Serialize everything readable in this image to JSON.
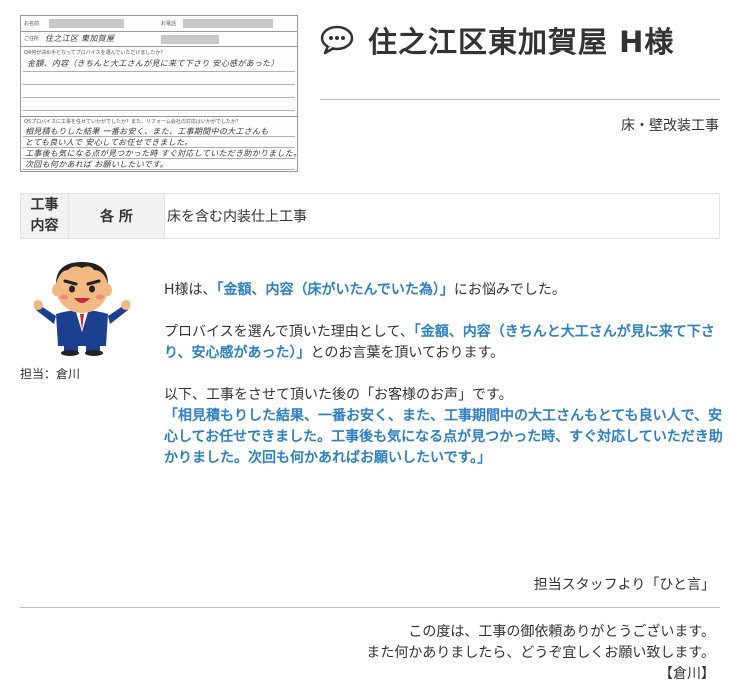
{
  "survey": {
    "name_label": "お名前",
    "phone_label": "お電話",
    "address_label": "ご住所",
    "address_hand": "住之江区 東加賀屋",
    "q4_label": "Q4何が決め手となってプロバイスを選んでいただけましたか？",
    "q4_hand": "金額、内容（きちんと大工さんが見に来て下さり 安心感があった）",
    "q5_label": "Q5プロバイスに工事を任せていかがでしたか？また、リフォーム会社の対応はいかがでしたか？",
    "q5_line1": "相見積もりした結果 一番お安く、また、工事期間中の大工さんも",
    "q5_line2": "とても良い人で 安心してお任せできました。",
    "q5_line3": "工事後も気になる点が見つかった時 すぐ対応していただき助かりました。",
    "q5_line4": "次回も何かあれば お願いしたいです。"
  },
  "header": {
    "title": "住之江区東加賀屋 H様",
    "work_type": "床・壁改装工事"
  },
  "work_table": {
    "head": "工事内容",
    "head_line1": "工事",
    "head_line2": "内容",
    "place": "各 所",
    "description": "床を含む内装仕上工事"
  },
  "staff": {
    "label": "担当：倉川"
  },
  "message": {
    "p1_pre": "H様は、",
    "p1_hl": "「金額、内容（床がいたんでいた為）」",
    "p1_post": "にお悩みでした。",
    "p2_pre": "プロバイスを選んで頂いた理由として、",
    "p2_hl": "「金額、内容（きちんと大工さんが見に来て下さり、安心感があった）」",
    "p2_post": "とのお言葉を頂いております。",
    "p3_pre": "以下、工事をさせて頂いた後の「お客様のお声」です。",
    "p3_hl": "「相見積もりした結果、一番お安く、また、工事期間中の大工さんもとても良い人で、安心してお任せできました。工事後も気になる点が見つかった時、すぐ対応していただき助かりました。次回も何かあればお願いしたいです。」"
  },
  "staff_comment": {
    "heading": "担当スタッフより「ひと言」",
    "line1": "この度は、工事の御依頼ありがとうございます。",
    "line2": "また何かありましたら、どうぞ宜しくお願い致します。",
    "signature": "【倉川】"
  },
  "colors": {
    "highlight": "#2d7fc8",
    "text": "#333333",
    "table_bg": "#f2f2f2"
  }
}
